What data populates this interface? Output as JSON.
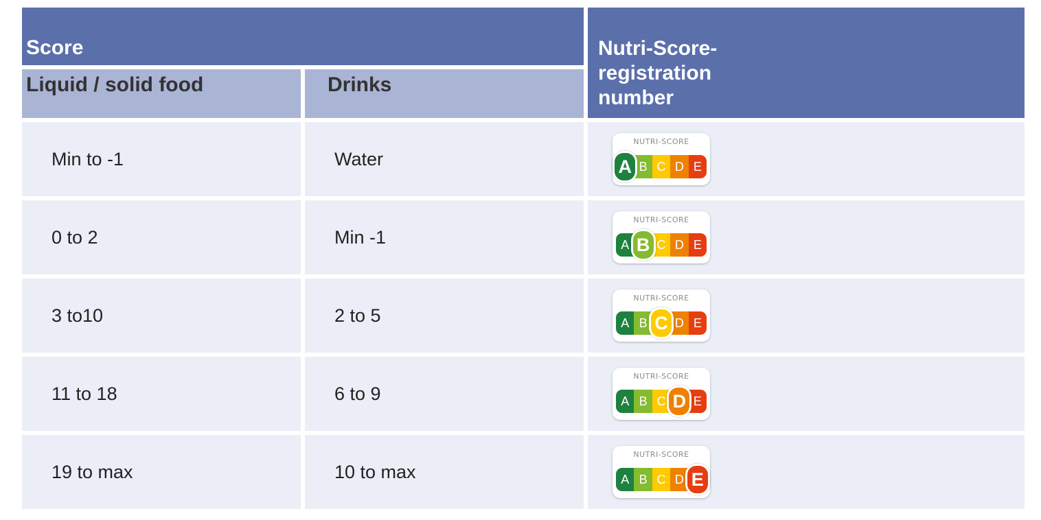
{
  "header": {
    "score": "Score",
    "nutri_score": "Nutri-Score-registration number",
    "liquid_solid": "Liquid / solid food",
    "drinks": "Drinks"
  },
  "badge_title": "NUTRI-SCORE",
  "grade_letters": [
    "A",
    "B",
    "C",
    "D",
    "E"
  ],
  "grade_colors": [
    "#1e8140",
    "#85bb2f",
    "#fecb02",
    "#ee8100",
    "#e63e11"
  ],
  "rows": [
    {
      "food": "Min to -1",
      "drinks": "Water",
      "grade": "A"
    },
    {
      "food": "0 to 2",
      "drinks": "Min -1",
      "grade": "B"
    },
    {
      "food": "3 to10",
      "drinks": "2 to 5",
      "grade": "C"
    },
    {
      "food": "11 to 18",
      "drinks": "6 to 9",
      "grade": "D"
    },
    {
      "food": "19 to max",
      "drinks": "10 to max",
      "grade": "E"
    }
  ]
}
